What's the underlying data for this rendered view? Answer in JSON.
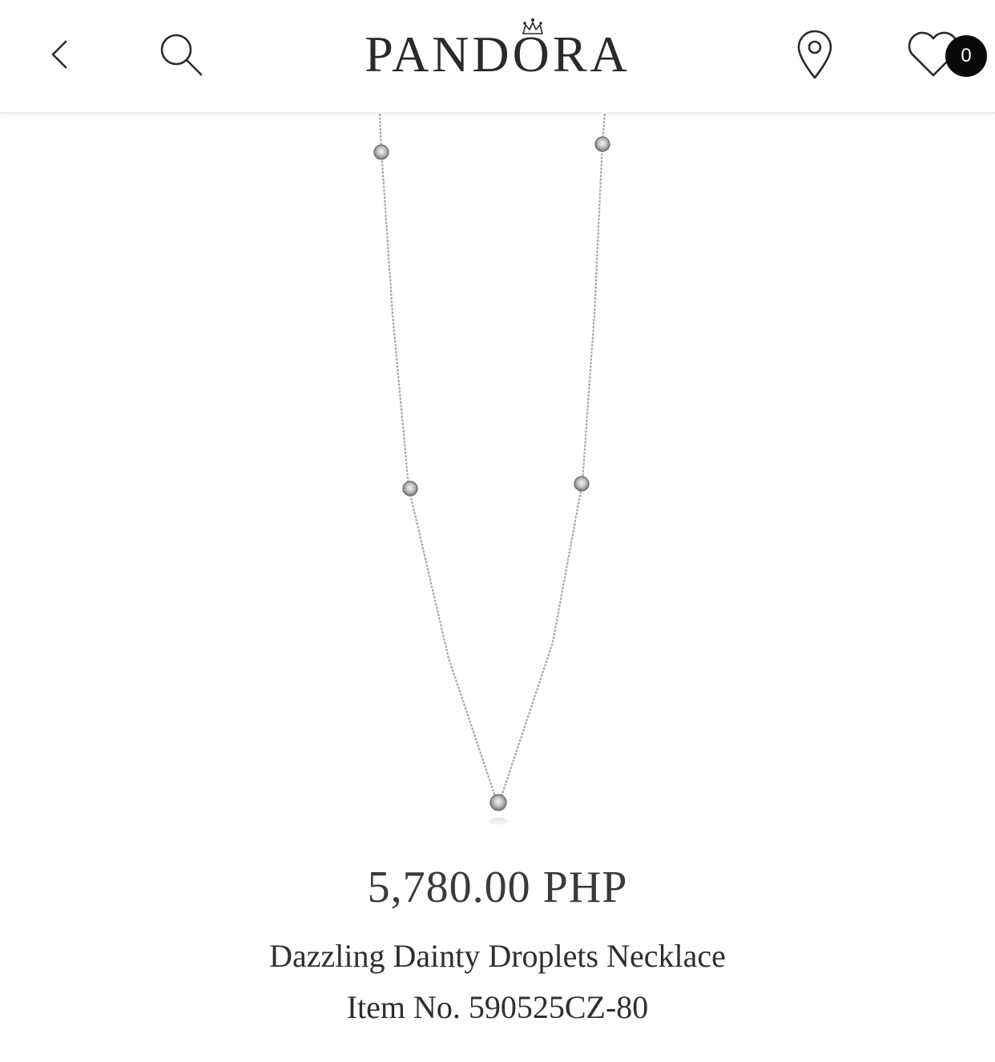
{
  "header": {
    "brand": "PANDORA",
    "back_icon": "chevron-left-icon",
    "search_icon": "search-icon",
    "store_icon": "location-pin-icon",
    "wishlist_icon": "heart-icon",
    "wishlist_count": "0"
  },
  "product": {
    "image_icon": "necklace-image",
    "price": "5,780.00 PHP",
    "name": "Dazzling Dainty Droplets Necklace",
    "item_no": "Item No. 590525CZ-80"
  },
  "colors": {
    "text": "#2b2b2b",
    "badge": "#0a0a0a",
    "divider": "#ececec"
  }
}
